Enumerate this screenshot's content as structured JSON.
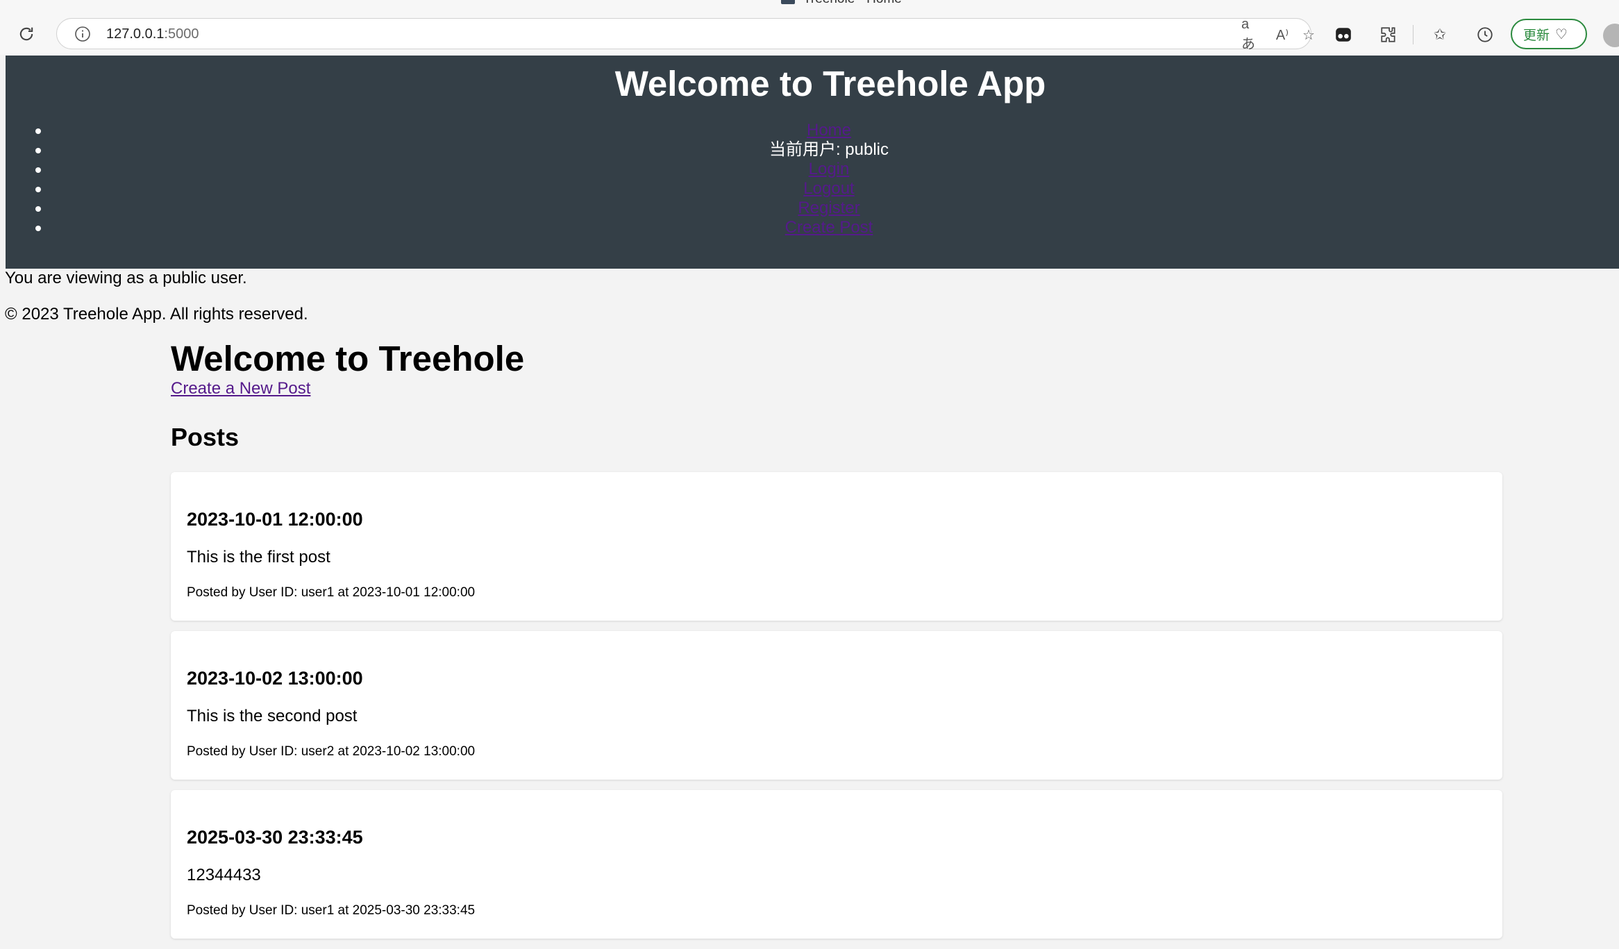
{
  "browser": {
    "tab_title": "Treehole - Home",
    "url_host": "127.0.0.1",
    "url_port": ":5000",
    "update_label": "更新"
  },
  "header": {
    "title": "Welcome to Treehole App",
    "nav": {
      "home": "Home",
      "current_user": "当前用户: public",
      "login": "Login",
      "logout": "Logout",
      "register": "Register",
      "create_post": "Create Post"
    }
  },
  "notice": "You are viewing as a public user.",
  "footer": {
    "copyright": "© 2023 Treehole App. All rights reserved."
  },
  "main": {
    "title": "Welcome to Treehole",
    "create_link": "Create a New Post",
    "posts_heading": "Posts",
    "posts": [
      {
        "date": "2023-10-01 12:00:00",
        "body": "This is the first post",
        "meta": "Posted by User ID: user1 at 2023-10-01 12:00:00"
      },
      {
        "date": "2023-10-02 13:00:00",
        "body": "This is the second post",
        "meta": "Posted by User ID: user2 at 2023-10-02 13:00:00"
      },
      {
        "date": "2025-03-30 23:33:45",
        "body": "12344433",
        "meta": "Posted by User ID: user1 at 2025-03-30 23:33:45"
      }
    ]
  },
  "colors": {
    "header_bg": "#343f47",
    "link": "#551a8b",
    "update_green": "#2b8a3e"
  }
}
